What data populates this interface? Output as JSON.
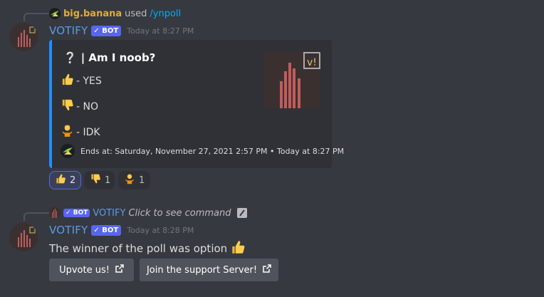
{
  "message1": {
    "reference": {
      "user": "big.banana",
      "used_text": "used",
      "command": "/ynpoll"
    },
    "author": "VOTIFY",
    "bot_tag": "BOT",
    "timestamp": "Today at 8:27 PM",
    "embed": {
      "accent_color": "#1e90ff",
      "title_prefix": "❔",
      "title": "| Am I noob?",
      "options": [
        {
          "emoji": "thumbs-up",
          "label": "- YES"
        },
        {
          "emoji": "thumbs-down",
          "label": "- NO"
        },
        {
          "emoji": "person-shrugging",
          "label": "- IDK"
        }
      ],
      "footer": "Ends at: Saturday, November 27, 2021 2:57 PM • Today at 8:27 PM"
    },
    "reactions": [
      {
        "emoji": "thumbs-up",
        "count": "2",
        "active": true
      },
      {
        "emoji": "thumbs-down",
        "count": "1",
        "active": false
      },
      {
        "emoji": "person-shrugging",
        "count": "1",
        "active": false
      }
    ]
  },
  "message2": {
    "reference": {
      "bot_tag": "BOT",
      "author": "VOTIFY",
      "hint": "Click to see command"
    },
    "author": "VOTIFY",
    "bot_tag": "BOT",
    "timestamp": "Today at 8:28 PM",
    "text": "The winner of the poll was option",
    "buttons": [
      {
        "label": "Upvote us!"
      },
      {
        "label": "Join the support Server!"
      }
    ]
  }
}
